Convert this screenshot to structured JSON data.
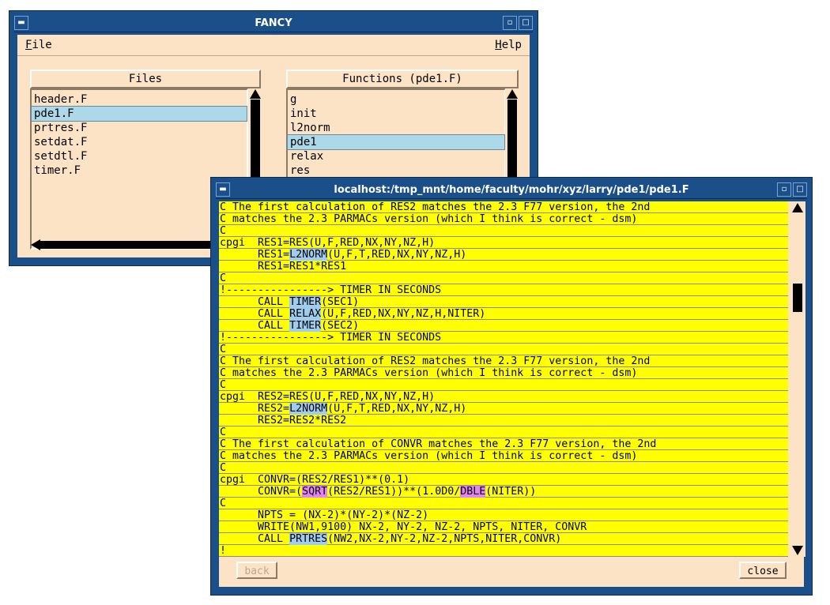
{
  "fancy": {
    "title": "FANCY",
    "menu": {
      "file": "File",
      "file_mnemonic": "F",
      "file_rest": "ile",
      "help": "Help",
      "help_mnemonic": "H",
      "help_rest": "elp"
    },
    "files_header": "Files",
    "functions_header": "Functions (pde1.F)",
    "files": [
      "header.F",
      "pde1.F",
      "prtres.F",
      "setdat.F",
      "setdtl.F",
      "timer.F"
    ],
    "files_selected": "pde1.F",
    "functions": [
      "g",
      "init",
      "l2norm",
      "pde1",
      "relax",
      "res"
    ],
    "functions_selected": "pde1"
  },
  "viewer": {
    "title": "localhost:/tmp_mnt/home/faculty/mohr/xyz/larry/pde1/pde1.F",
    "back_label": "back",
    "close_label": "close",
    "code_lines": [
      [
        {
          "t": "C The first calculation of RES2 matches the 2.3 F77 version, the 2nd"
        }
      ],
      [
        {
          "t": "C matches the 2.3 PARMACs version (which I think is correct - dsm)"
        }
      ],
      [
        {
          "t": "C"
        }
      ],
      [
        {
          "t": "cpgi  RES1=RES(U,F,RED,NX,NY,NZ,H)"
        }
      ],
      [
        {
          "t": "      RES1="
        },
        {
          "t": "L2NORM",
          "h": "b"
        },
        {
          "t": "(U,F,T,RED,NX,NY,NZ,H)"
        }
      ],
      [
        {
          "t": "      RES1=RES1*RES1"
        }
      ],
      [
        {
          "t": "C"
        }
      ],
      [
        {
          "t": "!----------------> TIMER IN SECONDS"
        }
      ],
      [
        {
          "t": "      CALL "
        },
        {
          "t": "TIMER",
          "h": "b"
        },
        {
          "t": "(SEC1)"
        }
      ],
      [
        {
          "t": "      CALL "
        },
        {
          "t": "RELAX",
          "h": "b"
        },
        {
          "t": "(U,F,RED,NX,NY,NZ,H,NITER)"
        }
      ],
      [
        {
          "t": "      CALL "
        },
        {
          "t": "TIMER",
          "h": "b"
        },
        {
          "t": "(SEC2)"
        }
      ],
      [
        {
          "t": "!----------------> TIMER IN SECONDS"
        }
      ],
      [
        {
          "t": "C"
        }
      ],
      [
        {
          "t": "C The first calculation of RES2 matches the 2.3 F77 version, the 2nd"
        }
      ],
      [
        {
          "t": "C matches the 2.3 PARMACs version (which I think is correct - dsm)"
        }
      ],
      [
        {
          "t": "C"
        }
      ],
      [
        {
          "t": "cpgi  RES2=RES(U,F,RED,NX,NY,NZ,H)"
        }
      ],
      [
        {
          "t": "      RES2="
        },
        {
          "t": "L2NORM",
          "h": "b"
        },
        {
          "t": "(U,F,T,RED,NX,NY,NZ,H)"
        }
      ],
      [
        {
          "t": "      RES2=RES2*RES2"
        }
      ],
      [
        {
          "t": "C"
        }
      ],
      [
        {
          "t": "C The first calculation of CONVR matches the 2.3 F77 version, the 2nd"
        }
      ],
      [
        {
          "t": "C matches the 2.3 PARMACs version (which I think is correct - dsm)"
        }
      ],
      [
        {
          "t": "C"
        }
      ],
      [
        {
          "t": "cpgi  CONVR=(RES2/RES1)**(0.1)"
        }
      ],
      [
        {
          "t": "      CONVR=("
        },
        {
          "t": "SQRT",
          "h": "m"
        },
        {
          "t": "(RES2/RES1))**(1.0D0/"
        },
        {
          "t": "DBLE",
          "h": "m"
        },
        {
          "t": "(NITER))"
        }
      ],
      [
        {
          "t": "C"
        }
      ],
      [
        {
          "t": "      NPTS = (NX-2)*(NY-2)*(NZ-2)"
        }
      ],
      [
        {
          "t": "      WRITE(NW1,9100) NX-2, NY-2, NZ-2, NPTS, NITER, CONVR"
        }
      ],
      [
        {
          "t": "      CALL "
        },
        {
          "t": "PRTRES",
          "h": "b"
        },
        {
          "t": "(NW2,NX-2,NY-2,NZ-2,NPTS,NITER,CONVR)"
        }
      ],
      [
        {
          "t": "!"
        }
      ]
    ]
  }
}
